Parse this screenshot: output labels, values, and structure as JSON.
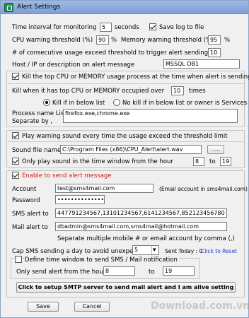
{
  "window": {
    "title": "Alert  Settings"
  },
  "monitor": {
    "interval_label": "Time interval for monitoring",
    "interval_value": "5",
    "interval_unit": "seconds",
    "save_log_label": "Save log to file",
    "cpu_label": "CPU warning threshold (%)",
    "cpu_value": "90",
    "percent": "%",
    "mem_label": "Memory warning threshold (%)",
    "mem_value": "95",
    "consecutive_label": "# of consecutive usage exceed threshold to trigger alert sending",
    "consecutive_value": "10",
    "host_label": "Host / IP or description on alert message",
    "host_value": "MSSQL DB1"
  },
  "kill": {
    "header": "Kill the top CPU or MEMORY usage process at the time when alert is sending",
    "when_label": "Kill when it has top CPU or MEMORY occupied over",
    "when_value": "10",
    "when_unit": "times",
    "option1": "Kill if in below list",
    "option2": "No kill if in below list or owner is Services",
    "process_label1": "Process name List",
    "process_label2": "Separate by ,",
    "process_value": "firefox.exe,chrome.exe"
  },
  "sound": {
    "header": "Play warning sound every time the usage exceed the threshold limit",
    "file_label": "Sound file name",
    "file_value": "C:\\Program Files (x86)\\CPU_Alert\\alert.wav",
    "browse_label": ".....",
    "window_label": "Only play sound in the time window from the hour",
    "from_value": "8",
    "to_label": "to",
    "to_value": "19"
  },
  "email": {
    "header": "Enable to send alert message",
    "account_label": "Account",
    "account_value": "test@sms4mail.com",
    "account_note": "(Email account in sms4mail.com)",
    "password_label": "Password",
    "password_value": "•••••••••••••••",
    "sms_label": "SMS alert to",
    "sms_value": "447791234567,13101234567,6141234567,852123456780",
    "mail_label": "Mail alert to",
    "mail_value": "dbadmin@sms4mail.com,sms4mail@hotmail.com",
    "separate_note": "Separate multiple mobile # or email account by comma (,)",
    "cap_label": "Cap SMS sending a day to avoid unexpected",
    "cap_value": "5",
    "sent_today": "Sent Today : 0",
    "reset_link": "Click to Reset",
    "time_window_label": "Define time window to send SMS / Mail notification",
    "only_send_label": "Only send alert from the hour",
    "from_value": "8",
    "to_label": "to",
    "to_value": "19",
    "smtp_button": "Click to setup SMTP server to send mail alert and I am alive setting"
  },
  "footer": {
    "save": "Save",
    "cancel": "Cancel"
  },
  "watermark": "Download.com.vn"
}
